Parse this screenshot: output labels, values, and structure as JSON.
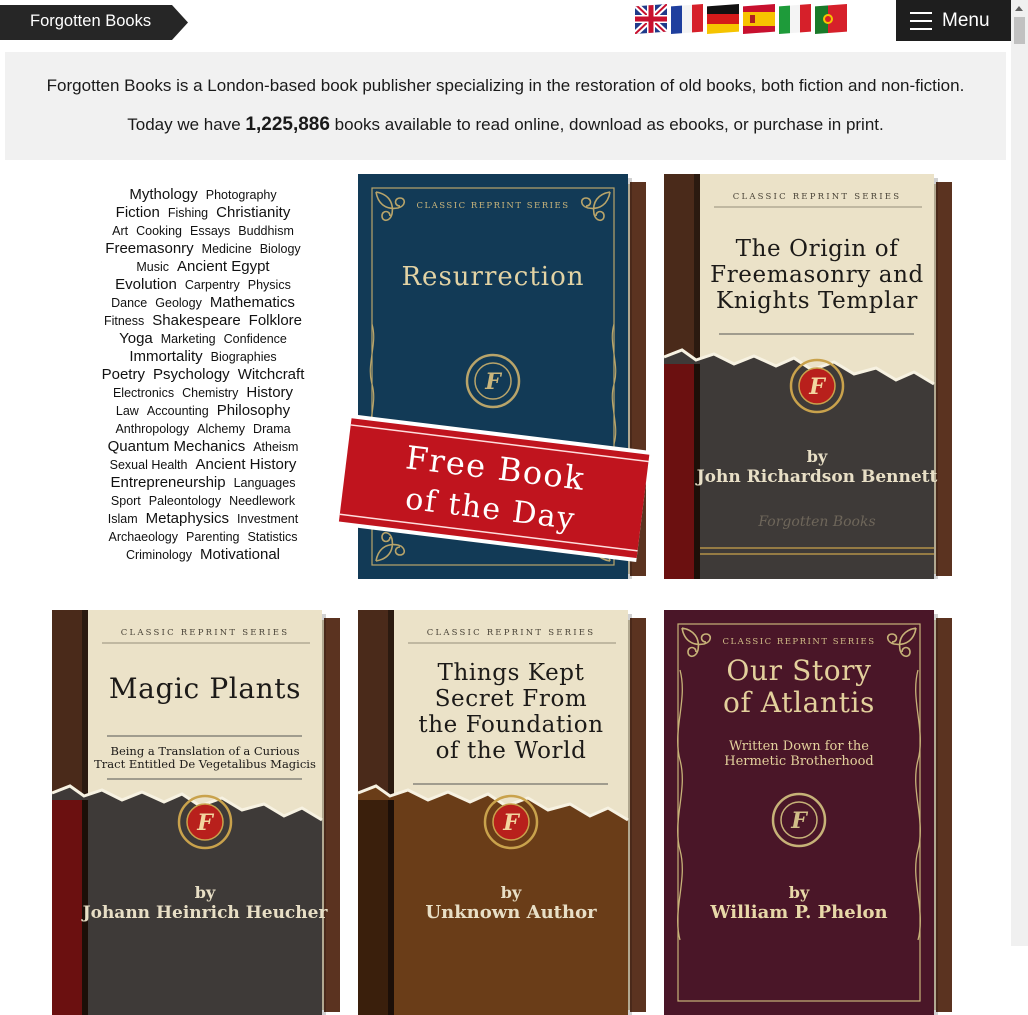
{
  "header": {
    "brand": "Forgotten Books",
    "menu_label": "Menu",
    "flags": [
      "uk-flag",
      "france-flag",
      "germany-flag",
      "spain-flag",
      "italy-flag",
      "portugal-flag"
    ]
  },
  "intro": {
    "line1": "Forgotten Books is a London-based book publisher specializing in the restoration of old books, both fiction and non-fiction.",
    "line2_prefix": "Today we have ",
    "book_count": "1,225,886",
    "line2_suffix": " books available to read online, download as ebooks, or purchase in print."
  },
  "tag_cloud": [
    [
      {
        "t": "Mythology",
        "s": "l"
      },
      {
        "t": "Photography",
        "s": "s"
      }
    ],
    [
      {
        "t": "Fiction",
        "s": "l"
      },
      {
        "t": "Fishing",
        "s": "s"
      },
      {
        "t": "Christianity",
        "s": "l"
      }
    ],
    [
      {
        "t": "Art",
        "s": "s"
      },
      {
        "t": "Cooking",
        "s": "s"
      },
      {
        "t": "Essays",
        "s": "s"
      },
      {
        "t": "Buddhism",
        "s": "s"
      }
    ],
    [
      {
        "t": "Freemasonry",
        "s": "l"
      },
      {
        "t": "Medicine",
        "s": "s"
      },
      {
        "t": "Biology",
        "s": "s"
      }
    ],
    [
      {
        "t": "Music",
        "s": "s"
      },
      {
        "t": "Ancient Egypt",
        "s": "l"
      }
    ],
    [
      {
        "t": "Evolution",
        "s": "l"
      },
      {
        "t": "Carpentry",
        "s": "s"
      },
      {
        "t": "Physics",
        "s": "s"
      }
    ],
    [
      {
        "t": "Dance",
        "s": "s"
      },
      {
        "t": "Geology",
        "s": "s"
      },
      {
        "t": "Mathematics",
        "s": "l"
      }
    ],
    [
      {
        "t": "Fitness",
        "s": "s"
      },
      {
        "t": "Shakespeare",
        "s": "l"
      },
      {
        "t": "Folklore",
        "s": "l"
      }
    ],
    [
      {
        "t": "Yoga",
        "s": "l"
      },
      {
        "t": "Marketing",
        "s": "s"
      },
      {
        "t": "Confidence",
        "s": "s"
      }
    ],
    [
      {
        "t": "Immortality",
        "s": "l"
      },
      {
        "t": "Biographies",
        "s": "s"
      }
    ],
    [
      {
        "t": "Poetry",
        "s": "l"
      },
      {
        "t": "Psychology",
        "s": "l"
      },
      {
        "t": "Witchcraft",
        "s": "l"
      }
    ],
    [
      {
        "t": "Electronics",
        "s": "s"
      },
      {
        "t": "Chemistry",
        "s": "s"
      },
      {
        "t": "History",
        "s": "l"
      }
    ],
    [
      {
        "t": "Law",
        "s": "s"
      },
      {
        "t": "Accounting",
        "s": "s"
      },
      {
        "t": "Philosophy",
        "s": "l"
      }
    ],
    [
      {
        "t": "Anthropology",
        "s": "s"
      },
      {
        "t": "Alchemy",
        "s": "s"
      },
      {
        "t": "Drama",
        "s": "s"
      }
    ],
    [
      {
        "t": "Quantum Mechanics",
        "s": "l"
      },
      {
        "t": "Atheism",
        "s": "s"
      }
    ],
    [
      {
        "t": "Sexual Health",
        "s": "s"
      },
      {
        "t": "Ancient History",
        "s": "l"
      }
    ],
    [
      {
        "t": "Entrepreneurship",
        "s": "l"
      },
      {
        "t": "Languages",
        "s": "s"
      }
    ],
    [
      {
        "t": "Sport",
        "s": "s"
      },
      {
        "t": "Paleontology",
        "s": "s"
      },
      {
        "t": "Needlework",
        "s": "s"
      }
    ],
    [
      {
        "t": "Islam",
        "s": "s"
      },
      {
        "t": "Metaphysics",
        "s": "l"
      },
      {
        "t": "Investment",
        "s": "s"
      }
    ],
    [
      {
        "t": "Archaeology",
        "s": "s"
      },
      {
        "t": "Parenting",
        "s": "s"
      },
      {
        "t": "Statistics",
        "s": "s"
      }
    ],
    [
      {
        "t": "Criminology",
        "s": "s"
      },
      {
        "t": "Motivational",
        "s": "l"
      }
    ]
  ],
  "books": [
    {
      "id": "resurrection",
      "style": "blue",
      "series": "CLASSIC REPRINT SERIES",
      "title_lines": [
        "Resurrection"
      ],
      "subtitle_lines": [],
      "author": "",
      "banner_lines": [
        "Free Book",
        "of the Day"
      ],
      "publisher": ""
    },
    {
      "id": "origin-freemasonry",
      "style": "cream-dark",
      "series": "CLASSIC REPRINT SERIES",
      "title_lines": [
        "The Origin of",
        "Freemasonry and",
        "Knights Templar"
      ],
      "subtitle_lines": [],
      "author_by": "by",
      "author": "John Richardson Bennett",
      "banner_lines": [],
      "publisher": "Forgotten Books"
    },
    {
      "id": "magic-plants",
      "style": "cream-dark",
      "series": "CLASSIC REPRINT SERIES",
      "title_lines": [
        "Magic Plants"
      ],
      "subtitle_lines": [
        "Being a Translation of a Curious",
        "Tract Entitled De Vegetalibus Magicis"
      ],
      "author_by": "by",
      "author": "Johann Heinrich Heucher",
      "banner_lines": [],
      "publisher": ""
    },
    {
      "id": "things-kept-secret",
      "style": "cream-brown",
      "series": "CLASSIC REPRINT SERIES",
      "title_lines": [
        "Things Kept",
        "Secret From",
        "the Foundation",
        "of the World"
      ],
      "subtitle_lines": [],
      "author_by": "by",
      "author": "Unknown Author",
      "banner_lines": [],
      "publisher": ""
    },
    {
      "id": "our-story-atlantis",
      "style": "purple",
      "series": "CLASSIC REPRINT SERIES",
      "title_lines": [
        "Our Story",
        "of Atlantis"
      ],
      "subtitle_lines": [
        "Written Down for the",
        "Hermetic Brotherhood"
      ],
      "author_by": "by",
      "author": "William P. Phelon",
      "banner_lines": [],
      "publisher": ""
    }
  ],
  "colors": {
    "blue_cover": "#123a56",
    "cream_cover": "#ebe2c8",
    "dark_lower": "#3e3a38",
    "brown_lower": "#6a3d18",
    "purple_cover": "#4a1628",
    "banner_red": "#c0141e",
    "spine": "#4a2a1a"
  }
}
